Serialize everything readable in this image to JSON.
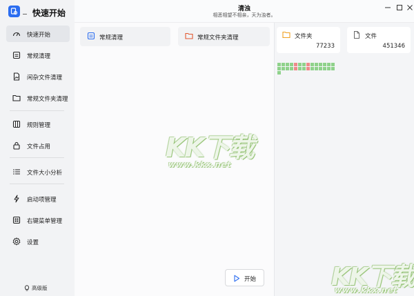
{
  "app": {
    "title": "快速开始",
    "window_title": "清浊",
    "window_subtitle": "相恶相望不相亲，天为浊者。"
  },
  "sidebar": {
    "items": [
      {
        "label": "快速开始",
        "icon": "gauge-icon",
        "active": true
      },
      {
        "label": "常规清理",
        "icon": "monitor-icon",
        "active": false
      },
      {
        "label": "闲杂文件清理",
        "icon": "file-image-icon",
        "active": false
      },
      {
        "label": "常规文件夹清理",
        "icon": "folder-icon",
        "active": false
      },
      {
        "label": "规则管理",
        "icon": "columns-icon",
        "active": false
      },
      {
        "label": "文件占用",
        "icon": "lock-icon",
        "active": false
      },
      {
        "label": "文件大小分析",
        "icon": "list-icon",
        "active": false
      },
      {
        "label": "启动项管理",
        "icon": "lightning-icon",
        "active": false
      },
      {
        "label": "右键菜单管理",
        "icon": "menu-grid-icon",
        "active": false
      },
      {
        "label": "设置",
        "icon": "gear-icon",
        "active": false
      }
    ],
    "premium_label": "高级版"
  },
  "main": {
    "tabs": [
      {
        "label": "常规清理",
        "icon": "monitor-icon"
      },
      {
        "label": "常规文件夹清理",
        "icon": "folder-icon"
      }
    ],
    "start_label": "开始"
  },
  "stats": [
    {
      "label": "文件夹",
      "value": "77233",
      "icon": "folder-icon"
    },
    {
      "label": "文件",
      "value": "451346",
      "icon": "file-icon"
    }
  ],
  "watermark": {
    "logo_text": "KK下载",
    "url": "www.kkx.net"
  },
  "colors": {
    "accent": "#2b6df0",
    "folder_orange": "#f0a020",
    "folder_red": "#e2572f",
    "grid_green": "#8fd28b",
    "grid_red": "#ee8a8a"
  }
}
